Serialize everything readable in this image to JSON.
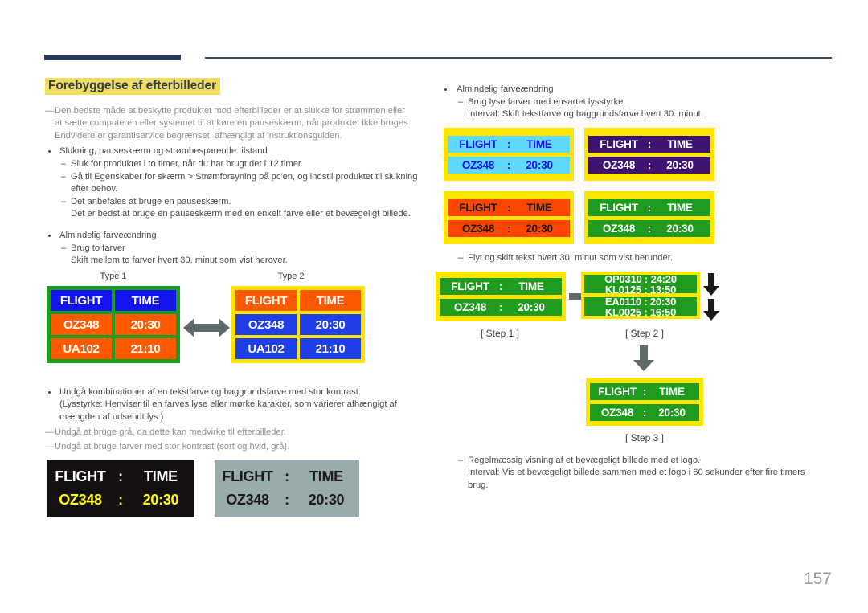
{
  "page": {
    "number": "157",
    "title": "Forebyggelse af efterbilleder"
  },
  "colors": {
    "header_bar": "#2b3a5c",
    "title_highlight": "#f2de5e",
    "yellow": "#ffe400",
    "green": "#1f9b1f",
    "blue": "#1414f0",
    "orange": "#ff5a00",
    "light_blue": "#62d8f8",
    "purple": "#3d1470",
    "dark_orange": "#ff4500",
    "black_panel": "#141010",
    "gray_panel": "#9aabab",
    "yellow_text": "#ffff00",
    "arrow_gray": "#5e6a6a",
    "page_number": "#9b9b9b"
  },
  "left_column": {
    "intro": {
      "dash": "—",
      "lines": [
        "Den bedste måde at beskytte produktet mod efterbilleder er at slukke for strømmen eller",
        "at sætte computeren eller systemet til at køre en pauseskærm, når produktet ikke bruges.",
        "Endvidere er garantiservice begrænset, afhængigt af instruktionsguiden."
      ]
    },
    "bullet1": {
      "label": "Slukning, pauseskærm og strømbesparende tilstand",
      "items": [
        {
          "dash": "–",
          "lines": [
            "Sluk for produktet i to timer, når du har brugt det i 12 timer."
          ]
        },
        {
          "dash": "–",
          "lines": [
            "Gå til Egenskaber for skærm > Strømforsyning på pc'en, og indstil produktet til slukning",
            "efter behov."
          ]
        },
        {
          "dash": "–",
          "lines": [
            "Det anbefales at bruge en pauseskærm.",
            "Det er bedst at bruge en pauseskærm med en enkelt farve eller et bevægeligt billede."
          ]
        }
      ]
    },
    "bullet2": {
      "label": "Almindelig farveændring",
      "items": [
        {
          "dash": "–",
          "lines": [
            "Brug to farver",
            "Skift mellem to farver hvert 30. minut som vist herover."
          ]
        }
      ]
    },
    "bullet3": {
      "label": "Undgå kombinationer af en tekstfarve og baggrundsfarve med stor kontrast.",
      "lines": [
        "(Lysstyrke: Henviser til en farves lyse eller mørke karakter, som varierer afhængigt af",
        "mængden af udsendt lys.)"
      ]
    },
    "notes": [
      {
        "dash": "—",
        "text": "Undgå at bruge grå, da dette kan medvirke til efterbilleder."
      },
      {
        "dash": "—",
        "text": "Undgå at bruge farver med stor kontrast (sort og hvid, grå)."
      }
    ],
    "type_tables": {
      "type1": {
        "label": "Type 1",
        "border_color": "#1f9b1f",
        "rows": [
          {
            "cells": [
              "FLIGHT",
              "TIME"
            ],
            "bg": "#1414f0",
            "fg": "#ffffff"
          },
          {
            "cells": [
              "OZ348",
              "20:30"
            ],
            "bg": "#ff5a00",
            "fg": "#ffffff"
          },
          {
            "cells": [
              "UA102",
              "21:10"
            ],
            "bg": "#ff5a00",
            "fg": "#ffffff"
          }
        ]
      },
      "type2": {
        "label": "Type 2",
        "border_color": "#ffe400",
        "rows": [
          {
            "cells": [
              "FLIGHT",
              "TIME"
            ],
            "bg": "#ff5a00",
            "fg": "#ffffff"
          },
          {
            "cells": [
              "OZ348",
              "20:30"
            ],
            "bg": "#1f3fe8",
            "fg": "#ffffff"
          },
          {
            "cells": [
              "UA102",
              "21:10"
            ],
            "bg": "#1f3fe8",
            "fg": "#ffffff"
          }
        ]
      },
      "arrow_icon": "double-arrow-horizontal"
    },
    "contrast_examples": [
      {
        "name": "black-background-example",
        "bg": "#141010",
        "rows": [
          {
            "c1": "FLIGHT",
            "c2": ":",
            "c3": "TIME",
            "fg": "#ffffff"
          },
          {
            "c1": "OZ348",
            "c2": ":",
            "c3": "20:30",
            "fg": "#ffff00"
          }
        ]
      },
      {
        "name": "gray-background-example",
        "bg": "#9aabab",
        "rows": [
          {
            "c1": "FLIGHT",
            "c2": ":",
            "c3": "TIME",
            "fg": "#1a1a1a"
          },
          {
            "c1": "OZ348",
            "c2": ":",
            "c3": "20:30",
            "fg": "#1a1a1a"
          }
        ]
      }
    ]
  },
  "right_column": {
    "bullet1": {
      "label": "Almindelig farveændring",
      "items": [
        {
          "dash": "–",
          "lines": [
            "Brug lyse farver med ensartet lysstyrke.",
            "Interval: Skift tekstfarve og baggrundsfarve hvert 30. minut."
          ]
        }
      ]
    },
    "color_panels": [
      {
        "name": "panel-light-blue",
        "frame": "#ffe400",
        "bg": "#62d8f8",
        "fg": "#1414f0",
        "rows": [
          {
            "c1": "FLIGHT",
            "c2": ":",
            "c3": "TIME"
          },
          {
            "c1": "OZ348",
            "c2": ":",
            "c3": "20:30"
          }
        ]
      },
      {
        "name": "panel-purple",
        "frame": "#ffe400",
        "bg": "#3d1470",
        "fg": "#ffffff",
        "rows": [
          {
            "c1": "FLIGHT",
            "c2": ":",
            "c3": "TIME"
          },
          {
            "c1": "OZ348",
            "c2": ":",
            "c3": "20:30"
          }
        ]
      },
      {
        "name": "panel-orange",
        "frame": "#ffe400",
        "bg": "#ff4500",
        "fg": "#1a1a1a",
        "rows": [
          {
            "c1": "FLIGHT",
            "c2": ":",
            "c3": "TIME"
          },
          {
            "c1": "OZ348",
            "c2": ":",
            "c3": "20:30"
          }
        ]
      },
      {
        "name": "panel-green",
        "frame": "#ffe400",
        "bg": "#1f9b1f",
        "fg": "#ffffff",
        "rows": [
          {
            "c1": "FLIGHT",
            "c2": ":",
            "c3": "TIME"
          },
          {
            "c1": "OZ348",
            "c2": ":",
            "c3": "20:30"
          }
        ]
      }
    ],
    "move_note": {
      "dash": "–",
      "text": "Flyt og skift tekst hvert 30. minut som vist herunder."
    },
    "steps": {
      "step1": {
        "label": "[ Step 1 ]",
        "frame": "#ffe400",
        "bg": "#1f9b1f",
        "fg": "#ffffff",
        "rows": [
          {
            "c1": "FLIGHT",
            "c2": ":",
            "c3": "TIME"
          },
          {
            "c1": "OZ348",
            "c2": ":",
            "c3": "20:30"
          }
        ]
      },
      "step2": {
        "label": "[ Step 2 ]",
        "frame": "#ffe400",
        "bg": "#1f9b1f",
        "fg": "#ffffff",
        "scroll_rows": [
          {
            "top": "OP0310  :  24:20",
            "bottom": "KL0125  :  13:50"
          },
          {
            "top": "EA0110  :  20:30",
            "bottom": "KL0025  :  16:50"
          }
        ],
        "arrow_icon": "double-arrow-down"
      },
      "step3": {
        "label": "[ Step 3 ]",
        "frame": "#ffe400",
        "bg": "#1f9b1f",
        "fg": "#ffffff",
        "rows": [
          {
            "c1": "FLIGHT",
            "c2": ":",
            "c3": "TIME"
          },
          {
            "c1": "OZ348",
            "c2": ":",
            "c3": "20:30"
          }
        ]
      },
      "arrow_right_icon": "arrow-right",
      "arrow_down_icon": "arrow-down"
    },
    "bottom_note": {
      "dash": "–",
      "lines": [
        "Regelmæssig visning af et bevægeligt billede med et logo.",
        "Interval: Vis et bevægeligt billede sammen med et logo i 60 sekunder efter fire timers",
        "brug."
      ]
    }
  }
}
